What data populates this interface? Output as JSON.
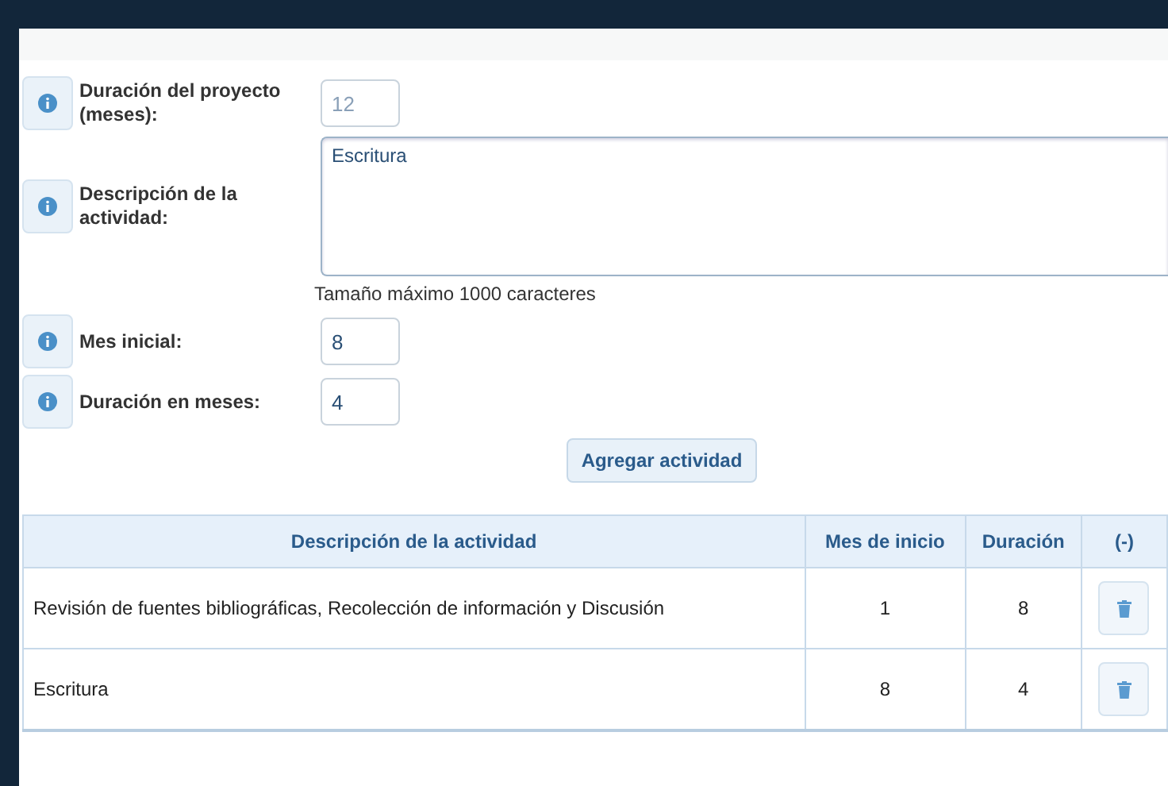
{
  "fields": [
    {
      "label": "Duración del proyecto (meses):",
      "kind": "input",
      "value": "12",
      "disabled": true
    },
    {
      "label": "Descripción de la actividad:",
      "kind": "textarea",
      "value": "Escritura",
      "hint": "Tamaño máximo 1000 caracteres",
      "disabled": false
    },
    {
      "label": "Mes inicial:",
      "kind": "input",
      "value": "8",
      "disabled": false
    },
    {
      "label": "Duración en meses:",
      "kind": "input",
      "value": "4",
      "disabled": false
    }
  ],
  "add_button": "Agregar actividad",
  "table": {
    "columns": [
      "Descripción de la actividad",
      "Mes de inicio",
      "Duración",
      "(-)"
    ],
    "rows": [
      {
        "description": "Revisión de fuentes bibliográficas, Recolección de información y Discusión",
        "start": "1",
        "duration": "8"
      },
      {
        "description": "Escritura",
        "start": "8",
        "duration": "4"
      }
    ]
  }
}
